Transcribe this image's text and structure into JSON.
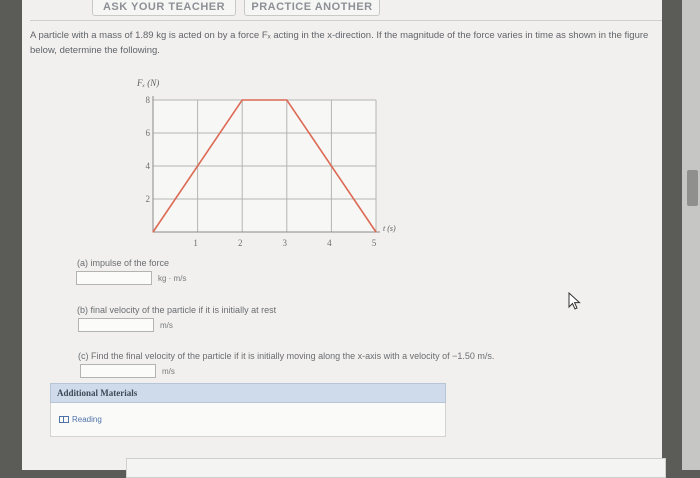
{
  "toolbar": {
    "ask_teacher_label": "ASK YOUR TEACHER",
    "practice_another_label": "PRACTICE ANOTHER"
  },
  "problem": {
    "text": "A particle with a mass of 1.89 kg is acted on by a force Fₓ acting in the x-direction. If the magnitude of the force varies in time as shown in the figure below, determine the following."
  },
  "chart_data": {
    "type": "line",
    "ylabel": "Fₓ (N)",
    "xlabel": "t (s)",
    "x_ticks": [
      "1",
      "2",
      "3",
      "4",
      "5"
    ],
    "y_ticks": [
      "2",
      "4",
      "6",
      "8"
    ],
    "xlim": [
      0,
      5
    ],
    "ylim": [
      0,
      8
    ],
    "grid": true,
    "series": [
      {
        "x": [
          0,
          2,
          3,
          5
        ],
        "y": [
          0,
          8,
          8,
          0
        ]
      }
    ],
    "line_color": "#dc6a55",
    "grid_color": "#b4b4b1"
  },
  "parts": {
    "a": {
      "label": "(a) impulse of the force",
      "value": "",
      "unit": "kg · m/s"
    },
    "b": {
      "label": "(b) final velocity of the particle if it is initially at rest",
      "value": "",
      "unit": "m/s"
    },
    "c": {
      "label": "(c) Find the final velocity of the particle if it is initially moving along the x-axis with a velocity of −1.50 m/s.",
      "value": "",
      "unit": "m/s"
    }
  },
  "additional": {
    "title": "Additional Materials",
    "reading_label": "Reading"
  }
}
